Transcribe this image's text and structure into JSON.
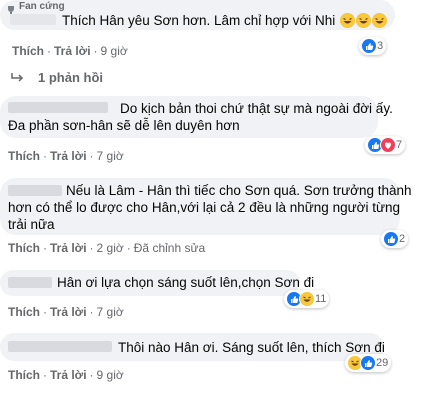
{
  "badge": {
    "label": "Fan cứng"
  },
  "actions": {
    "like": "Thích",
    "reply": "Trả lời"
  },
  "comments": [
    {
      "text": "Thích Hân yêu Sơn hơn. Lâm chỉ hợp với Nhi",
      "time": "9 giờ",
      "reaction_count": "3",
      "reactions": [
        "like"
      ]
    },
    {
      "text_line1": "Do kịch bản thoi chứ thật sự mà ngoài đời ấy.",
      "text_line2": "Đa phần sơn-hân sẽ dễ lên duyên hơn",
      "time": "7 giờ",
      "reaction_count": "7",
      "reactions": [
        "like",
        "love"
      ]
    },
    {
      "text_line1": "Nếu là Lâm - Hân thì tiếc cho Sơn quá. Sơn trưởng thành",
      "text_line2": "hơn có thể lo được cho Hân,với lại cả 2 đều là những người từng",
      "text_line3": "trải nữa",
      "time": "2 giờ",
      "edited": "Đã chỉnh sửa",
      "reaction_count": "2",
      "reactions": [
        "like"
      ]
    },
    {
      "text": "Hân ơi lựa chọn sáng suốt lên,chọn Sơn đi",
      "time": "7 giờ",
      "reaction_count": "11",
      "reactions": [
        "like",
        "haha"
      ]
    },
    {
      "text": "Thôi nào Hân ơi. Sáng suốt lên, thích Sơn đi",
      "time": "9 giờ",
      "reaction_count": "29",
      "reactions": [
        "haha",
        "like"
      ]
    }
  ],
  "replies": {
    "label": "1 phản hồi"
  },
  "colors": {
    "like": "#1877f2",
    "haha": "#f7c73c",
    "love": "#f33e58",
    "meta": "#65676b",
    "bubble": "#f0f2f5"
  }
}
